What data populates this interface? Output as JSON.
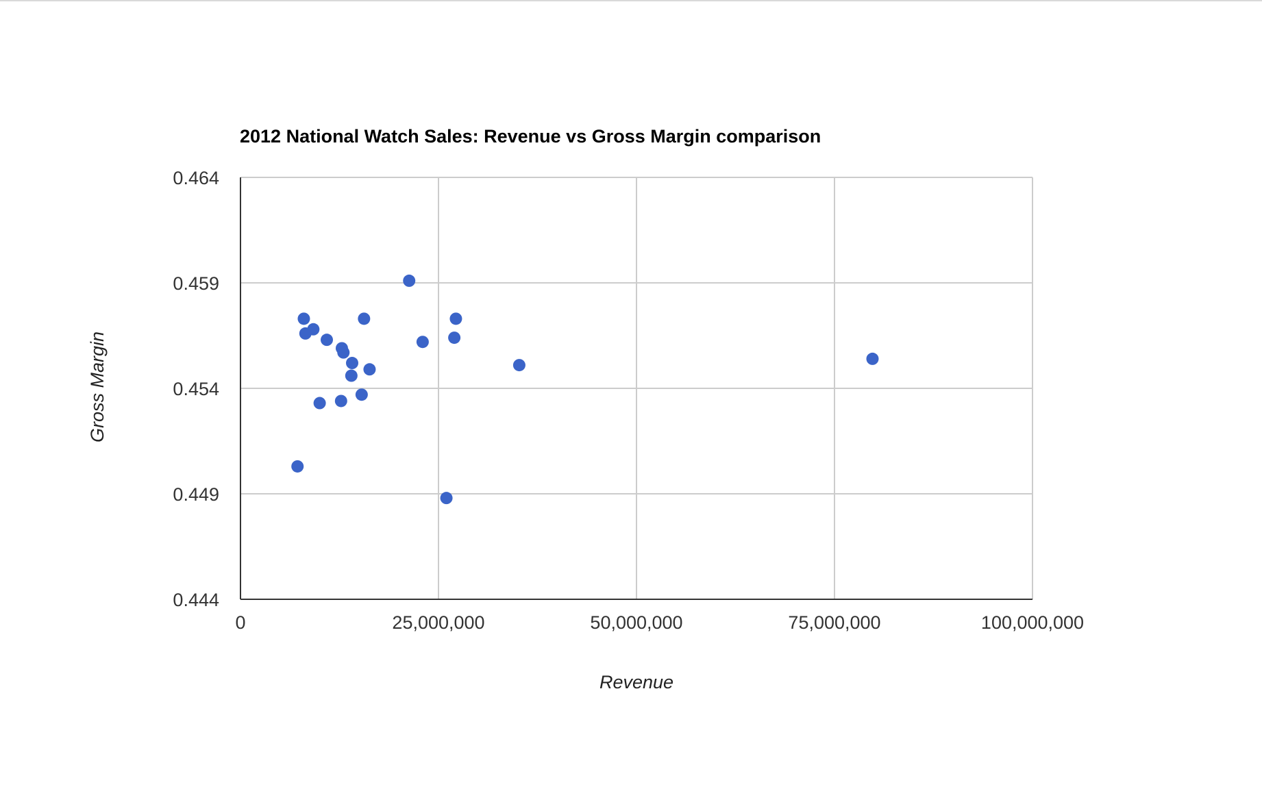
{
  "chart_data": {
    "type": "scatter",
    "title": "2012 National Watch Sales: Revenue vs Gross Margin comparison",
    "xlabel": "Revenue",
    "ylabel": "Gross Margin",
    "xlim": [
      0,
      100000000
    ],
    "ylim": [
      0.444,
      0.464
    ],
    "x_ticks": [
      0,
      25000000,
      50000000,
      75000000,
      100000000
    ],
    "x_tick_labels": [
      "0",
      "25,000,000",
      "50,000,000",
      "75,000,000",
      "100,000,000"
    ],
    "y_ticks": [
      0.444,
      0.449,
      0.454,
      0.459,
      0.464
    ],
    "y_tick_labels": [
      "0.444",
      "0.449",
      "0.454",
      "0.459",
      "0.464"
    ],
    "grid": true,
    "legend": "none",
    "marker_color": "#3b64c8",
    "points": [
      {
        "x": 7200000,
        "y": 0.4503
      },
      {
        "x": 8000000,
        "y": 0.4573
      },
      {
        "x": 8200000,
        "y": 0.4566
      },
      {
        "x": 9200000,
        "y": 0.4568
      },
      {
        "x": 10000000,
        "y": 0.4533
      },
      {
        "x": 10900000,
        "y": 0.4563
      },
      {
        "x": 12700000,
        "y": 0.4534
      },
      {
        "x": 12800000,
        "y": 0.4559
      },
      {
        "x": 13000000,
        "y": 0.4557
      },
      {
        "x": 14000000,
        "y": 0.4546
      },
      {
        "x": 14100000,
        "y": 0.4552
      },
      {
        "x": 15300000,
        "y": 0.4537
      },
      {
        "x": 15600000,
        "y": 0.4573
      },
      {
        "x": 16300000,
        "y": 0.4549
      },
      {
        "x": 21300000,
        "y": 0.4591
      },
      {
        "x": 23000000,
        "y": 0.4562
      },
      {
        "x": 26000000,
        "y": 0.4488
      },
      {
        "x": 27000000,
        "y": 0.4564
      },
      {
        "x": 27200000,
        "y": 0.4573
      },
      {
        "x": 35200000,
        "y": 0.4551
      },
      {
        "x": 79800000,
        "y": 0.4554
      }
    ]
  }
}
